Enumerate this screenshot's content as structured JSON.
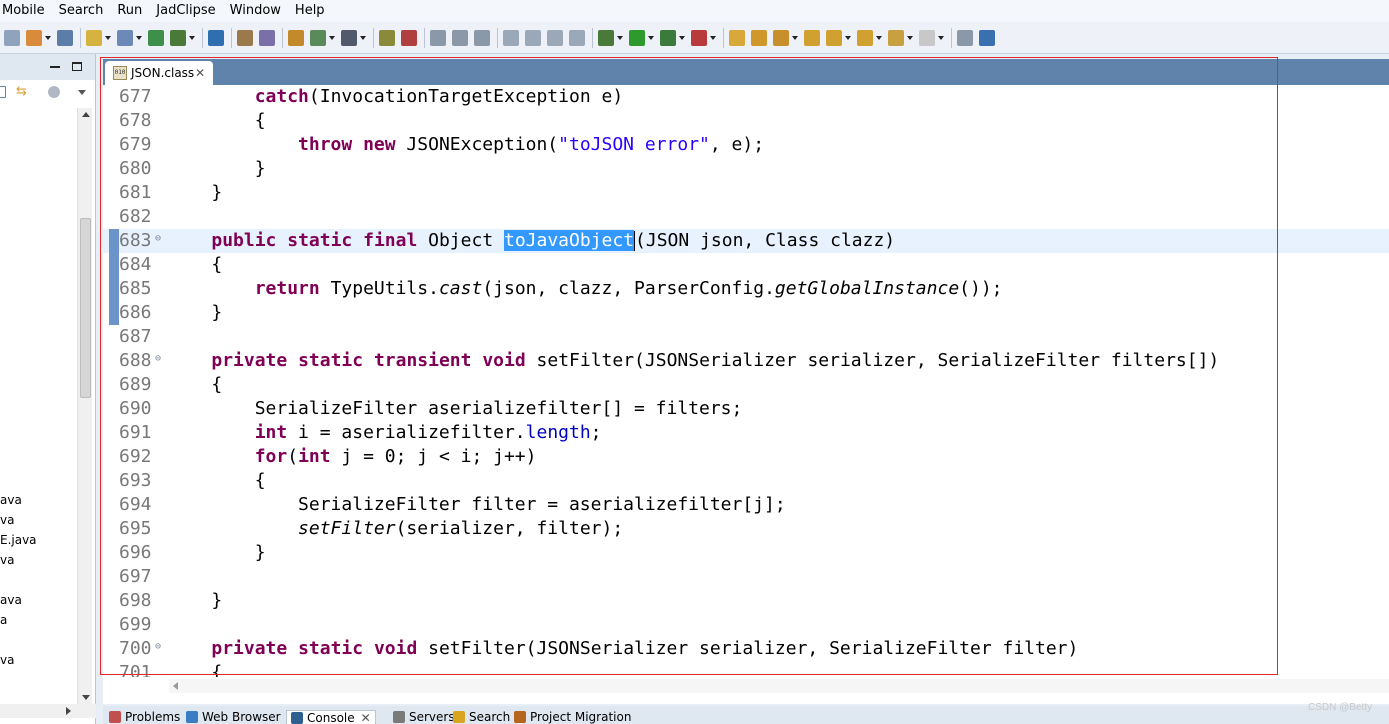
{
  "menu": [
    "Mobile",
    "Search",
    "Run",
    "JadClipse",
    "Window",
    "Help"
  ],
  "editor": {
    "tab_title": "JSON.class",
    "tab_close": "✕",
    "lines": [
      {
        "num": "677",
        "parts": [
          {
            "t": "        "
          },
          {
            "t": "catch",
            "c": "kw"
          },
          {
            "t": "(InvocationTargetException e)"
          }
        ]
      },
      {
        "num": "678",
        "parts": [
          {
            "t": "        {"
          }
        ]
      },
      {
        "num": "679",
        "parts": [
          {
            "t": "            "
          },
          {
            "t": "throw",
            "c": "kw"
          },
          {
            "t": " "
          },
          {
            "t": "new",
            "c": "kw"
          },
          {
            "t": " JSONException("
          },
          {
            "t": "\"toJSON error\"",
            "c": "str"
          },
          {
            "t": ", e);"
          }
        ]
      },
      {
        "num": "680",
        "parts": [
          {
            "t": "        }"
          }
        ]
      },
      {
        "num": "681",
        "parts": [
          {
            "t": "    }"
          }
        ]
      },
      {
        "num": "682",
        "parts": [
          {
            "t": ""
          }
        ]
      },
      {
        "num": "683",
        "fold": "⊖",
        "mark": true,
        "current": true,
        "parts": [
          {
            "t": "    "
          },
          {
            "t": "public",
            "c": "kw"
          },
          {
            "t": " "
          },
          {
            "t": "static",
            "c": "kw"
          },
          {
            "t": " "
          },
          {
            "t": "final",
            "c": "kw"
          },
          {
            "t": " Object "
          },
          {
            "t": "toJavaObject",
            "c": "hl"
          },
          {
            "t": "",
            "c": "caret"
          },
          {
            "t": "(JSON json, Class clazz)"
          }
        ]
      },
      {
        "num": "684",
        "mark": true,
        "parts": [
          {
            "t": "    {"
          }
        ]
      },
      {
        "num": "685",
        "mark": true,
        "parts": [
          {
            "t": "        "
          },
          {
            "t": "return",
            "c": "kw"
          },
          {
            "t": " TypeUtils."
          },
          {
            "t": "cast",
            "c": "it"
          },
          {
            "t": "(json, clazz, ParserConfig."
          },
          {
            "t": "getGlobalInstance",
            "c": "it"
          },
          {
            "t": "());"
          }
        ]
      },
      {
        "num": "686",
        "mark": true,
        "parts": [
          {
            "t": "    }"
          }
        ]
      },
      {
        "num": "687",
        "parts": [
          {
            "t": ""
          }
        ]
      },
      {
        "num": "688",
        "fold": "⊖",
        "parts": [
          {
            "t": "    "
          },
          {
            "t": "private",
            "c": "kw"
          },
          {
            "t": " "
          },
          {
            "t": "static",
            "c": "kw"
          },
          {
            "t": " "
          },
          {
            "t": "transient",
            "c": "kw"
          },
          {
            "t": " "
          },
          {
            "t": "void",
            "c": "kw"
          },
          {
            "t": " setFilter(JSONSerializer serializer, SerializeFilter filters[])"
          }
        ]
      },
      {
        "num": "689",
        "parts": [
          {
            "t": "    {"
          }
        ]
      },
      {
        "num": "690",
        "parts": [
          {
            "t": "        SerializeFilter aserializefilter[] = filters;"
          }
        ]
      },
      {
        "num": "691",
        "parts": [
          {
            "t": "        "
          },
          {
            "t": "int",
            "c": "kw"
          },
          {
            "t": " i = aserializefilter."
          },
          {
            "t": "length",
            "c": "fld"
          },
          {
            "t": ";"
          }
        ]
      },
      {
        "num": "692",
        "parts": [
          {
            "t": "        "
          },
          {
            "t": "for",
            "c": "kw"
          },
          {
            "t": "("
          },
          {
            "t": "int",
            "c": "kw"
          },
          {
            "t": " j = 0; j < i; j++)"
          }
        ]
      },
      {
        "num": "693",
        "parts": [
          {
            "t": "        {"
          }
        ]
      },
      {
        "num": "694",
        "parts": [
          {
            "t": "            SerializeFilter filter = aserializefilter[j];"
          }
        ]
      },
      {
        "num": "695",
        "parts": [
          {
            "t": "            "
          },
          {
            "t": "setFilter",
            "c": "it"
          },
          {
            "t": "(serializer, filter);"
          }
        ]
      },
      {
        "num": "696",
        "parts": [
          {
            "t": "        }"
          }
        ]
      },
      {
        "num": "697",
        "parts": [
          {
            "t": ""
          }
        ]
      },
      {
        "num": "698",
        "parts": [
          {
            "t": "    }"
          }
        ]
      },
      {
        "num": "699",
        "parts": [
          {
            "t": ""
          }
        ]
      },
      {
        "num": "700",
        "fold": "⊖",
        "parts": [
          {
            "t": "    "
          },
          {
            "t": "private",
            "c": "kw"
          },
          {
            "t": " "
          },
          {
            "t": "static",
            "c": "kw"
          },
          {
            "t": " "
          },
          {
            "t": "void",
            "c": "kw"
          },
          {
            "t": " setFilter(JSONSerializer serializer, SerializeFilter filter)"
          }
        ]
      },
      {
        "num": "701",
        "parts": [
          {
            "t": "    {"
          }
        ]
      }
    ]
  },
  "package_explorer": {
    "files": [
      "ava",
      "va",
      "E.java",
      "va",
      "",
      "ava",
      "a",
      "",
      "va"
    ]
  },
  "bottom_tabs": [
    {
      "label": "Problems",
      "icon": "problems-icon",
      "color": "#c0504d"
    },
    {
      "label": "Web Browser",
      "icon": "globe-icon",
      "color": "#3b7dc4"
    },
    {
      "label": "Console",
      "icon": "console-icon",
      "color": "#2f5f8f",
      "active": true,
      "close": "✕"
    },
    {
      "label": "Servers",
      "icon": "servers-icon",
      "color": "#7a7a7a"
    },
    {
      "label": "Search",
      "icon": "search-icon",
      "color": "#d9a520"
    },
    {
      "label": "Project Migration",
      "icon": "migration-icon",
      "color": "#b5651d"
    }
  ],
  "toolbar_icons": [
    {
      "name": "forward-icon",
      "color": "#8fa3bd",
      "dd": false
    },
    {
      "name": "new-wizard-icon",
      "color": "#d98a3a",
      "dd": true
    },
    {
      "name": "save-all-icon",
      "color": "#5c7da8",
      "dd": false
    },
    {
      "name": "new-project-icon",
      "color": "#d6b340",
      "dd": true
    },
    {
      "name": "new-server-icon",
      "color": "#6b8ab8",
      "dd": true
    },
    {
      "name": "deploy-icon",
      "color": "#3d8f4a",
      "dd": false
    },
    {
      "name": "publish-icon",
      "color": "#4a7a3a",
      "dd": true
    },
    {
      "name": "web-icon",
      "color": "#2f6fb0",
      "dd": false
    },
    {
      "name": "jar-icon",
      "color": "#9a7a4a",
      "dd": false
    },
    {
      "name": "package-icon",
      "color": "#7a6fa8",
      "dd": false
    },
    {
      "name": "class-icon",
      "color": "#c28a2a",
      "dd": false
    },
    {
      "name": "open-type-icon",
      "color": "#5a8a5a",
      "dd": true
    },
    {
      "name": "camera-icon",
      "color": "#505a6a",
      "dd": true
    },
    {
      "name": "task-icon",
      "color": "#8a8a3a",
      "dd": false
    },
    {
      "name": "pin-icon",
      "color": "#b04040",
      "dd": false
    },
    {
      "name": "refresh-icon",
      "color": "#8a98a8",
      "dd": false
    },
    {
      "name": "redo-icon",
      "color": "#8a98a8",
      "dd": false
    },
    {
      "name": "step-icon",
      "color": "#8a98a8",
      "dd": false
    },
    {
      "name": "resume-icon",
      "color": "#9aa8b8",
      "dd": false
    },
    {
      "name": "suspend-icon",
      "color": "#9aa8b8",
      "dd": false
    },
    {
      "name": "terminate-icon",
      "color": "#9aa8b8",
      "dd": false
    },
    {
      "name": "disconnect-icon",
      "color": "#9aa8b8",
      "dd": false
    },
    {
      "name": "debug-icon",
      "color": "#4a7a3a",
      "dd": true
    },
    {
      "name": "run-icon",
      "color": "#2e9a2e",
      "dd": true
    },
    {
      "name": "coverage-icon",
      "color": "#3a7a3a",
      "dd": true
    },
    {
      "name": "external-tools-icon",
      "color": "#b83a3a",
      "dd": true
    },
    {
      "name": "open-folder-icon",
      "color": "#d8a83a",
      "dd": false
    },
    {
      "name": "open-file-icon",
      "color": "#d0982a",
      "dd": false
    },
    {
      "name": "brush-icon",
      "color": "#c8902a",
      "dd": true
    },
    {
      "name": "next-annotation-icon",
      "color": "#d0a030",
      "dd": false
    },
    {
      "name": "prev-annotation-icon",
      "color": "#d0a030",
      "dd": true
    },
    {
      "name": "last-edit-icon",
      "color": "#d0a030",
      "dd": true
    },
    {
      "name": "back-icon",
      "color": "#c8a040",
      "dd": true
    },
    {
      "name": "forward-nav-icon",
      "color": "#c8c8c8",
      "dd": true
    },
    {
      "name": "open-external-icon",
      "color": "#8a98a8",
      "dd": false
    },
    {
      "name": "jad-icon",
      "color": "#3a6fb0",
      "dd": false
    }
  ],
  "watermark": "CSDN @Betty"
}
